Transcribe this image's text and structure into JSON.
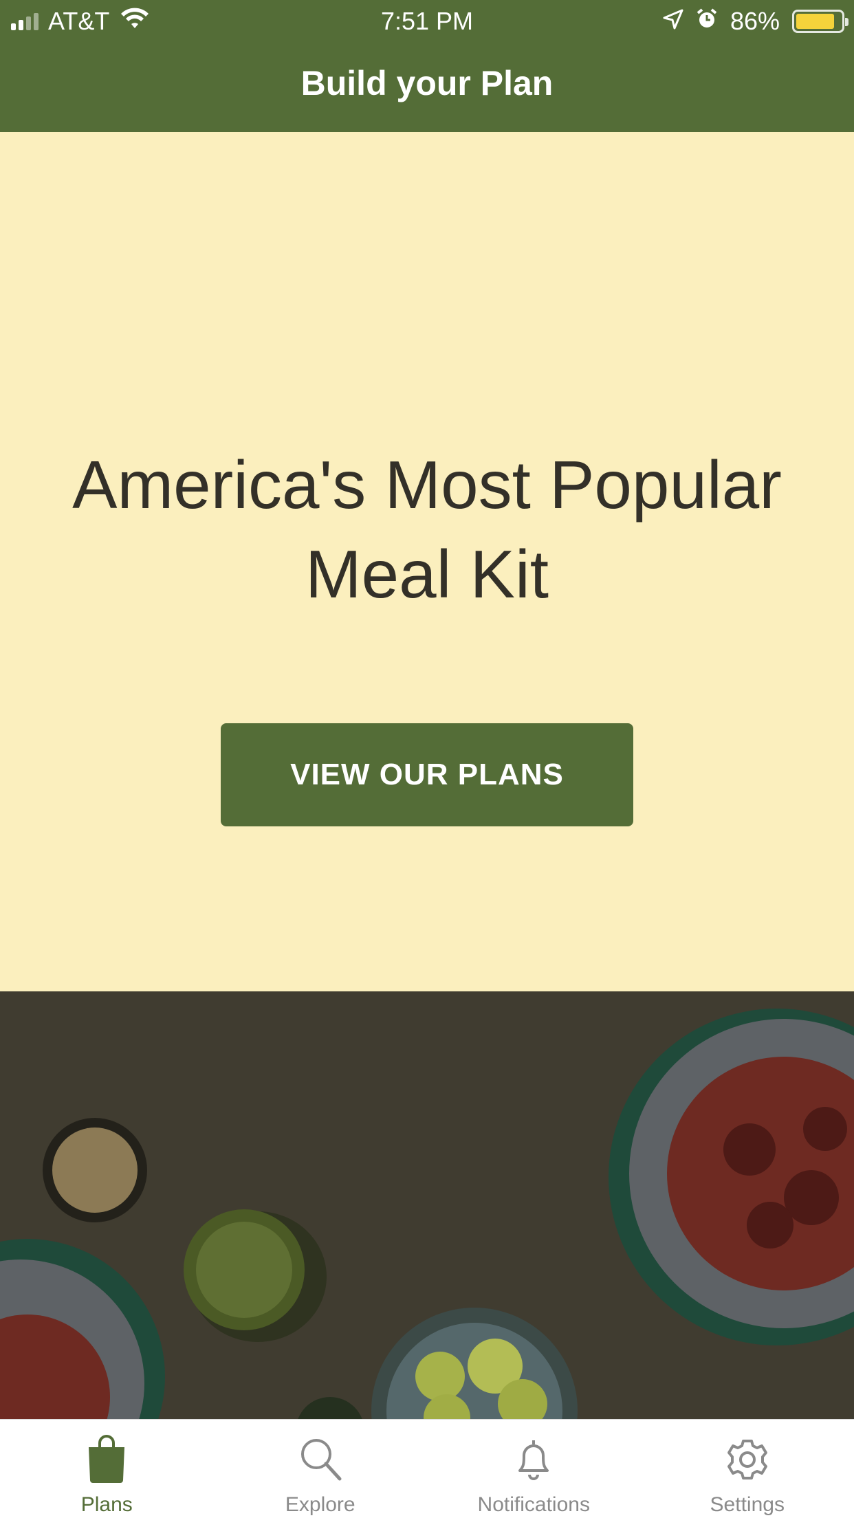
{
  "status_bar": {
    "carrier": "AT&T",
    "time": "7:51 PM",
    "battery": "86%",
    "battery_level": 0.86
  },
  "header": {
    "title": "Build your Plan"
  },
  "hero": {
    "title": "America's Most Popular Meal Kit",
    "cta_label": "VIEW OUR PLANS"
  },
  "tabs": [
    {
      "label": "Plans",
      "icon": "shopping-bag-icon",
      "active": true
    },
    {
      "label": "Explore",
      "icon": "search-icon",
      "active": false
    },
    {
      "label": "Notifications",
      "icon": "bell-icon",
      "active": false
    },
    {
      "label": "Settings",
      "icon": "gear-icon",
      "active": false
    }
  ],
  "colors": {
    "brand_green": "#546d37",
    "hero_background": "#fbefbe",
    "inactive_tab": "#8a8a8a"
  }
}
